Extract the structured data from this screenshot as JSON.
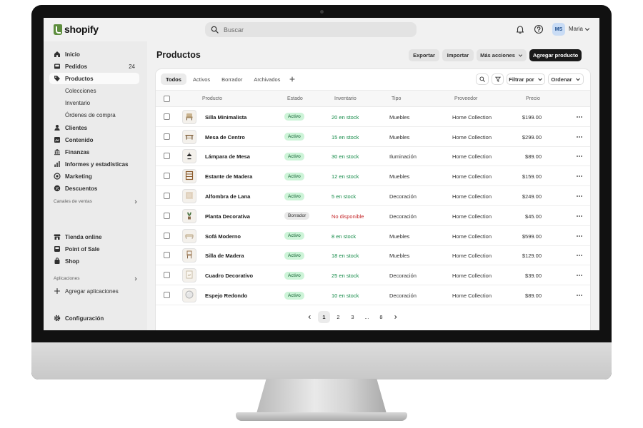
{
  "app": {
    "logo_text": "shopify",
    "brand_color": "#5e8e3e"
  },
  "topbar": {
    "search_placeholder": "Buscar",
    "user_initials": "MS",
    "user_name": "Maria"
  },
  "sidebar": {
    "items": [
      {
        "label": "Inicio",
        "icon": "home-icon"
      },
      {
        "label": "Pedidos",
        "icon": "inbox-icon",
        "badge": "24"
      },
      {
        "label": "Productos",
        "icon": "tag-icon",
        "active": true
      },
      {
        "label": "Colecciones",
        "sub": true
      },
      {
        "label": "Inventario",
        "sub": true
      },
      {
        "label": "Órdenes de compra",
        "sub": true
      },
      {
        "label": "Clientes",
        "icon": "person-icon"
      },
      {
        "label": "Contenido",
        "icon": "content-icon"
      },
      {
        "label": "Finanzas",
        "icon": "bank-icon"
      },
      {
        "label": "Informes y estadísticas",
        "icon": "chart-icon"
      },
      {
        "label": "Marketing",
        "icon": "target-icon"
      },
      {
        "label": "Descuentos",
        "icon": "discount-icon"
      }
    ],
    "sales_channels_label": "Canales de ventas",
    "sales_channels": [
      {
        "label": "Tienda online",
        "icon": "store-icon"
      },
      {
        "label": "Point of Sale",
        "icon": "pos-icon"
      },
      {
        "label": "Shop",
        "icon": "bag-icon"
      }
    ],
    "apps_label": "Aplicaciones",
    "add_apps_label": "Agregar aplicaciones",
    "settings_label": "Configuración"
  },
  "main": {
    "title": "Productos",
    "export_label": "Exportar",
    "import_label": "Importar",
    "more_actions_label": "Más acciones",
    "add_product_label": "Agregar producto",
    "tabs": [
      "Todos",
      "Activos",
      "Borrador",
      "Archivados"
    ],
    "filter_label": "Filtrar por",
    "sort_label": "Ordenar",
    "columns": [
      "Producto",
      "Estado",
      "Inventario",
      "Tipo",
      "Proveedor",
      "Precio"
    ],
    "rows": [
      {
        "name": "Silla Minimalista",
        "status": "Activo",
        "inventory": "20 en stock",
        "type": "Muebles",
        "vendor": "Home Collection",
        "price": "$199.00",
        "thumb": "chair-icon"
      },
      {
        "name": "Mesa de Centro",
        "status": "Activo",
        "inventory": "15 en stock",
        "type": "Muebles",
        "vendor": "Home Collection",
        "price": "$299.00",
        "thumb": "table-icon"
      },
      {
        "name": "Lámpara de Mesa",
        "status": "Activo",
        "inventory": "30 en stock",
        "type": "Iluminación",
        "vendor": "Home Collection",
        "price": "$89.00",
        "thumb": "lamp-icon"
      },
      {
        "name": "Estante de Madera",
        "status": "Activo",
        "inventory": "12 en stock",
        "type": "Muebles",
        "vendor": "Home Collection",
        "price": "$159.00",
        "thumb": "shelf-icon"
      },
      {
        "name": "Alfombra de Lana",
        "status": "Activo",
        "inventory": "5 en stock",
        "type": "Decoración",
        "vendor": "Home Collection",
        "price": "$249.00",
        "thumb": "rug-icon"
      },
      {
        "name": "Planta Decorativa",
        "status": "Borrador",
        "inventory": "No disponible",
        "type": "Decoración",
        "vendor": "Home Collection",
        "price": "$45.00",
        "thumb": "plant-icon"
      },
      {
        "name": "Sofá Moderno",
        "status": "Activo",
        "inventory": "8 en stock",
        "type": "Muebles",
        "vendor": "Home Collection",
        "price": "$599.00",
        "thumb": "sofa-icon"
      },
      {
        "name": "Silla de Madera",
        "status": "Activo",
        "inventory": "18 en stock",
        "type": "Muebles",
        "vendor": "Home Collection",
        "price": "$129.00",
        "thumb": "wood-chair-icon"
      },
      {
        "name": "Cuadro Decorativo",
        "status": "Activo",
        "inventory": "25 en stock",
        "type": "Decoración",
        "vendor": "Home Collection",
        "price": "$39.00",
        "thumb": "frame-icon"
      },
      {
        "name": "Espejo Redondo",
        "status": "Activo",
        "inventory": "10 en stock",
        "type": "Decoración",
        "vendor": "Home Collection",
        "price": "$89.00",
        "thumb": "mirror-icon"
      }
    ],
    "pagination": {
      "pages": [
        "1",
        "2",
        "3",
        "...",
        "8"
      ],
      "current": "1"
    }
  }
}
